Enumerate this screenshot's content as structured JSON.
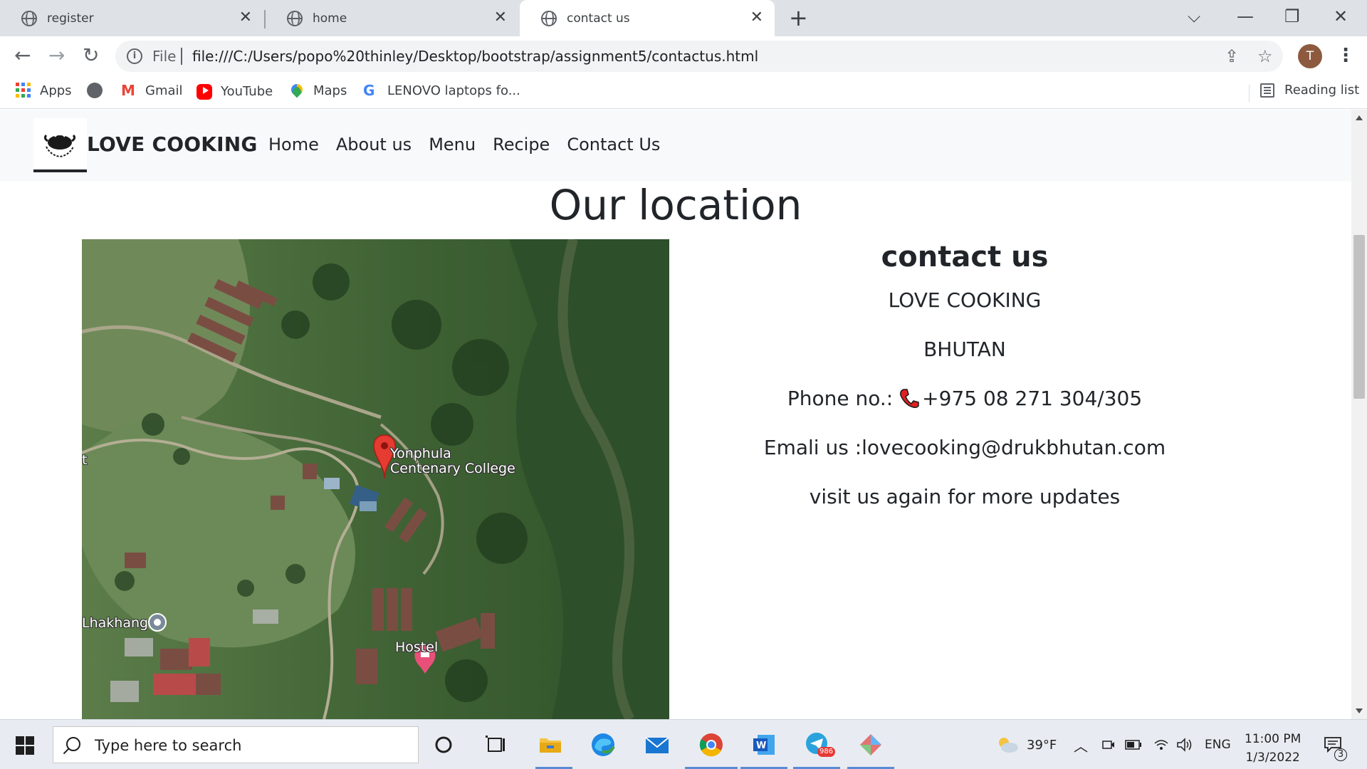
{
  "browser": {
    "tabs": [
      {
        "title": "register",
        "active": false
      },
      {
        "title": "home",
        "active": false
      },
      {
        "title": "contact us",
        "active": true
      }
    ],
    "address": {
      "scheme_label": "File",
      "url": "file:///C:/Users/popo%20thinley/Desktop/bootstrap/assignment5/contactus.html"
    },
    "profile_initial": "T",
    "bookmarks": [
      {
        "label": "Apps",
        "icon": "apps-grid-icon"
      },
      {
        "label": "",
        "icon": "globe-icon"
      },
      {
        "label": "Gmail",
        "icon": "gmail-icon"
      },
      {
        "label": "YouTube",
        "icon": "youtube-icon"
      },
      {
        "label": "Maps",
        "icon": "maps-icon"
      },
      {
        "label": "LENOVO laptops fo...",
        "icon": "google-icon"
      }
    ],
    "reading_list_label": "Reading list"
  },
  "site": {
    "brand": "LOVE COOKING",
    "nav": [
      "Home",
      "About us",
      "Menu",
      "Recipe",
      "Contact Us"
    ],
    "section_title": "Our location",
    "map_labels": {
      "college": "Yonphula\nCentenary College",
      "hostel": "Hostel",
      "lhakhang": "Lhakhang",
      "edge": "t"
    },
    "contact": {
      "heading": "contact us",
      "name": "LOVE COOKING",
      "country": "BHUTAN",
      "phone_label": "Phone no.:",
      "phone_number": "+975 08 271 304/305",
      "email": "Emali us :lovecooking@drukbhutan.com",
      "note": "visit us again for more updates"
    }
  },
  "taskbar": {
    "search_placeholder": "Type here to search",
    "telegram_badge": "986",
    "weather": "39°F",
    "language": "ENG",
    "time": "11:00 PM",
    "date": "1/3/2022",
    "notification_count": "3"
  }
}
